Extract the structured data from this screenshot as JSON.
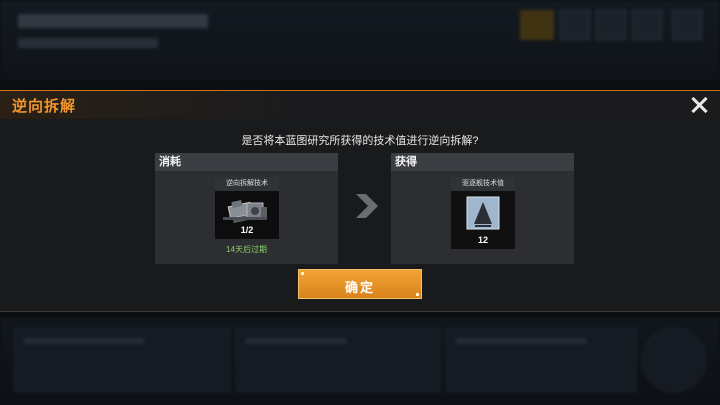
{
  "dialog": {
    "title": "逆向拆解",
    "question": "是否将本蓝图研究所获得的技术值进行逆向拆解?"
  },
  "consume": {
    "header": "消耗",
    "item_name": "逆向拆解技术",
    "count": "1/2",
    "expire_text": "14天后过期",
    "icon": "machinery-icon"
  },
  "gain": {
    "header": "获得",
    "item_name": "驱逐舰技术值",
    "count": "12",
    "icon": "destroyer-tech-icon"
  },
  "confirm": {
    "label": "确定"
  },
  "colors": {
    "accent": "#f0962a",
    "button": "#e8921f",
    "expire": "#8fd16a"
  }
}
